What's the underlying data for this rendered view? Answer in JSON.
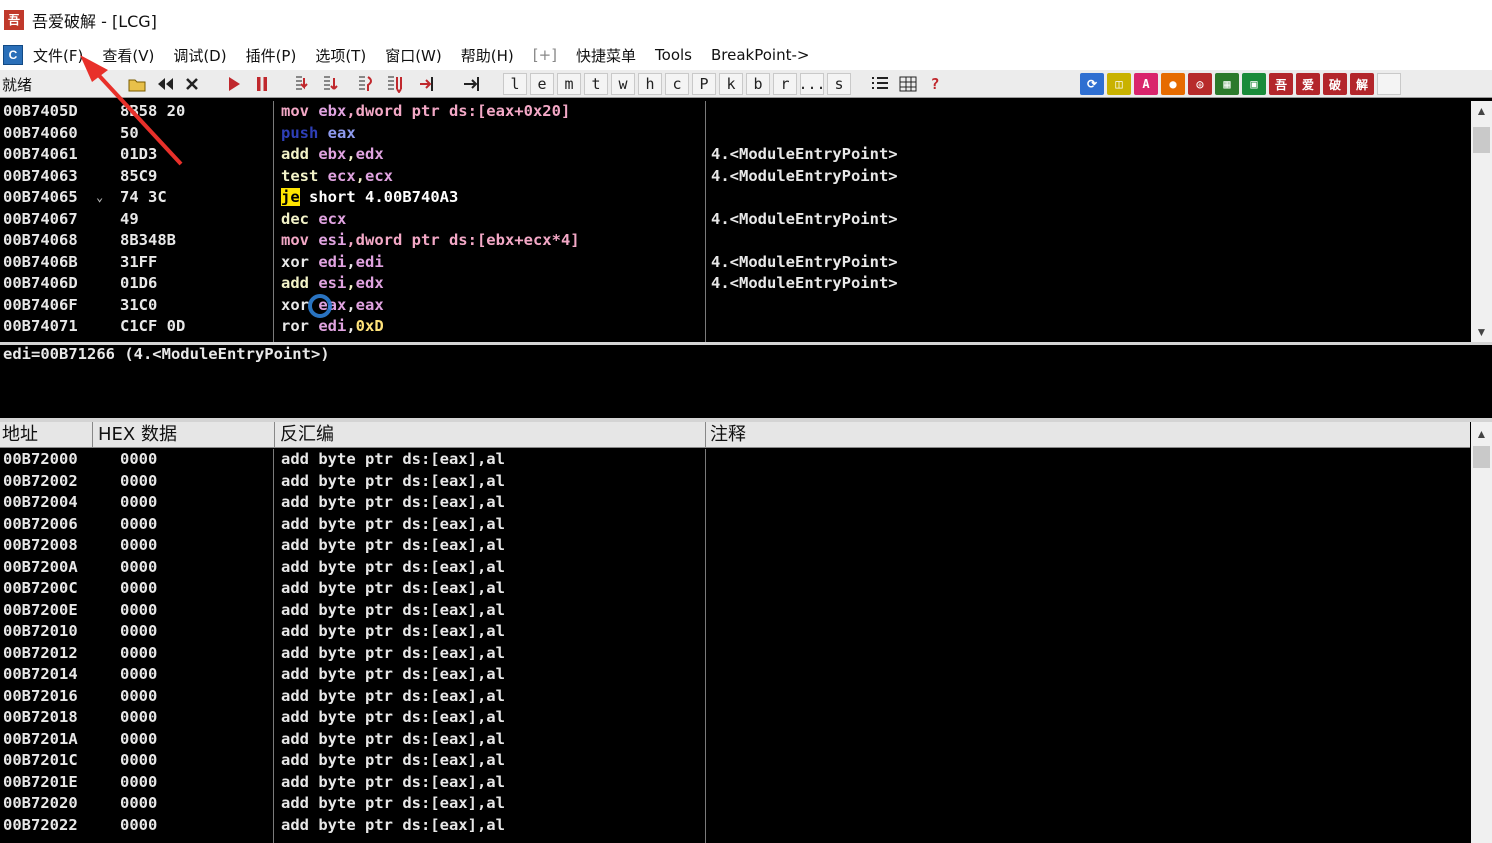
{
  "window": {
    "title": "吾爱破解 - [LCG]",
    "app_icon_glyph": "吾"
  },
  "menu": {
    "sys_glyph": "C",
    "items": [
      "文件(F)",
      "查看(V)",
      "调试(D)",
      "插件(P)",
      "选项(T)",
      "窗口(W)",
      "帮助(H)",
      "[+]",
      "快捷菜单",
      "Tools",
      "BreakPoint->"
    ]
  },
  "toolbar": {
    "status": "就绪",
    "letters": [
      "l",
      "e",
      "m",
      "t",
      "w",
      "h",
      "c",
      "P",
      "k",
      "b",
      "r",
      "...",
      "s"
    ],
    "icons": [
      "open-icon",
      "rewind-icon",
      "close-icon",
      "run-icon",
      "pause-icon",
      "step-into-icon",
      "step-over-icon",
      "trace-into-icon",
      "trace-over-icon",
      "execute-till-return-icon",
      "goto-icon",
      "list-icon",
      "grid-icon",
      "help-icon"
    ],
    "right_icons": [
      {
        "name": "refresh-icon",
        "glyph": "⟳",
        "color": "#2f6fd1"
      },
      {
        "name": "ollyscript-icon",
        "glyph": "◫",
        "color": "#c9b200"
      },
      {
        "name": "a-icon",
        "glyph": "A",
        "color": "#d9246c"
      },
      {
        "name": "circle-icon",
        "glyph": "●",
        "color": "#e66b00"
      },
      {
        "name": "target-icon",
        "glyph": "◎",
        "color": "#b72b2b"
      },
      {
        "name": "bookmark-icon",
        "glyph": "▦",
        "color": "#2c7a2c"
      },
      {
        "name": "memory-icon",
        "glyph": "▣",
        "color": "#1a8b3a"
      },
      {
        "name": "wu-icon",
        "glyph": "吾",
        "color": "#b3262b"
      },
      {
        "name": "ai-icon",
        "glyph": "爱",
        "color": "#b3262b"
      },
      {
        "name": "po-icon",
        "glyph": "破",
        "color": "#b3262b"
      },
      {
        "name": "jie-icon",
        "glyph": "解",
        "color": "#b3262b"
      }
    ]
  },
  "cpu": {
    "rows": [
      {
        "addr": "00B7405D",
        "hex": "8B58 20",
        "dis": [
          [
            "t-mov",
            "mov "
          ],
          [
            "t-reg",
            "ebx"
          ],
          [
            "t-mov",
            ",dword ptr ds:[eax+0x20]"
          ]
        ],
        "cmt": "",
        "jump": ""
      },
      {
        "addr": "00B74060",
        "hex": "50",
        "dis": [
          [
            "t-push",
            "push "
          ],
          [
            "t-pushreg",
            "eax"
          ]
        ],
        "cmt": "",
        "jump": ""
      },
      {
        "addr": "00B74061",
        "hex": "01D3",
        "dis": [
          [
            "t-add",
            "add "
          ],
          [
            "t-reg",
            "ebx"
          ],
          [
            "t-add",
            ","
          ],
          [
            "t-reg",
            "edx"
          ]
        ],
        "cmt": "4.<ModuleEntryPoint>",
        "jump": ""
      },
      {
        "addr": "00B74063",
        "hex": "85C9",
        "dis": [
          [
            "t-test",
            "test "
          ],
          [
            "t-reg",
            "ecx"
          ],
          [
            "t-test",
            ","
          ],
          [
            "t-reg",
            "ecx"
          ]
        ],
        "cmt": "4.<ModuleEntryPoint>",
        "jump": ""
      },
      {
        "addr": "00B74065",
        "hex": "74 3C",
        "dis": [
          [
            "t-je",
            "je"
          ],
          [
            "t-white",
            " short 4.00B740A3"
          ]
        ],
        "cmt": "",
        "jump": "⌄"
      },
      {
        "addr": "00B74067",
        "hex": "49",
        "dis": [
          [
            "t-add",
            "dec "
          ],
          [
            "t-reg",
            "ecx"
          ]
        ],
        "cmt": "4.<ModuleEntryPoint>",
        "jump": ""
      },
      {
        "addr": "00B74068",
        "hex": "8B348B",
        "dis": [
          [
            "t-mov",
            "mov "
          ],
          [
            "t-reg",
            "esi"
          ],
          [
            "t-mov",
            ",dword ptr ds:[ebx+ecx*4]"
          ]
        ],
        "cmt": "",
        "jump": ""
      },
      {
        "addr": "00B7406B",
        "hex": "31FF",
        "dis": [
          [
            "t-xor",
            "xor "
          ],
          [
            "t-reg",
            "edi"
          ],
          [
            "t-xor",
            ","
          ],
          [
            "t-reg",
            "edi"
          ]
        ],
        "cmt": "4.<ModuleEntryPoint>",
        "jump": ""
      },
      {
        "addr": "00B7406D",
        "hex": "01D6",
        "dis": [
          [
            "t-add",
            "add "
          ],
          [
            "t-reg",
            "esi"
          ],
          [
            "t-add",
            ","
          ],
          [
            "t-reg",
            "edx"
          ]
        ],
        "cmt": "4.<ModuleEntryPoint>",
        "jump": ""
      },
      {
        "addr": "00B7406F",
        "hex": "31C0",
        "dis": [
          [
            "t-xor",
            "xor "
          ],
          [
            "t-reg",
            "eax"
          ],
          [
            "t-xor",
            ","
          ],
          [
            "t-reg",
            "eax"
          ]
        ],
        "cmt": "",
        "jump": ""
      },
      {
        "addr": "00B74071",
        "hex": "C1CF 0D",
        "dis": [
          [
            "t-xor",
            "ror "
          ],
          [
            "t-reg",
            "edi"
          ],
          [
            "t-xor",
            ","
          ],
          [
            "t-yellow",
            "0xD"
          ]
        ],
        "cmt": "",
        "jump": ""
      }
    ]
  },
  "info": {
    "text": "edi=00B71266 (4.<ModuleEntryPoint>)"
  },
  "dump": {
    "headers": {
      "addr": "地址",
      "hex": "HEX 数据",
      "dis": "反汇编",
      "cmt": "注释"
    },
    "instruction": "add byte ptr ds:[eax],al",
    "rows": [
      {
        "addr": "00B72000",
        "hex": "0000"
      },
      {
        "addr": "00B72002",
        "hex": "0000"
      },
      {
        "addr": "00B72004",
        "hex": "0000"
      },
      {
        "addr": "00B72006",
        "hex": "0000"
      },
      {
        "addr": "00B72008",
        "hex": "0000"
      },
      {
        "addr": "00B7200A",
        "hex": "0000"
      },
      {
        "addr": "00B7200C",
        "hex": "0000"
      },
      {
        "addr": "00B7200E",
        "hex": "0000"
      },
      {
        "addr": "00B72010",
        "hex": "0000"
      },
      {
        "addr": "00B72012",
        "hex": "0000"
      },
      {
        "addr": "00B72014",
        "hex": "0000"
      },
      {
        "addr": "00B72016",
        "hex": "0000"
      },
      {
        "addr": "00B72018",
        "hex": "0000"
      },
      {
        "addr": "00B7201A",
        "hex": "0000"
      },
      {
        "addr": "00B7201C",
        "hex": "0000"
      },
      {
        "addr": "00B7201E",
        "hex": "0000"
      },
      {
        "addr": "00B72020",
        "hex": "0000"
      },
      {
        "addr": "00B72022",
        "hex": "0000"
      }
    ]
  },
  "colors": {
    "background": "#000000",
    "annotation_arrow": "#e8302a",
    "cursor_ring": "#2e7fd6"
  }
}
